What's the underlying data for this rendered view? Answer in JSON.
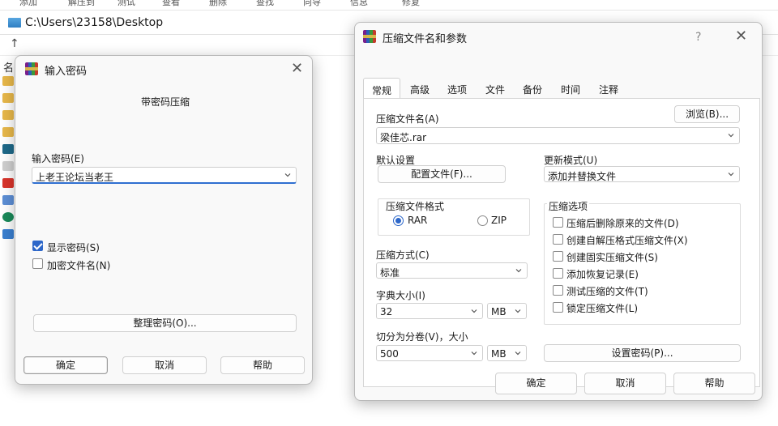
{
  "background": {
    "menu_items": [
      "添加",
      "解压到",
      "测试",
      "查看",
      "删除",
      "查找",
      "向导",
      "信息",
      "修复"
    ],
    "address_path": "C:\\Users\\23158\\Desktop",
    "column_header": "名"
  },
  "password_dialog": {
    "title": "输入密码",
    "subtitle": "带密码压缩",
    "password_label": "输入密码(E)",
    "password_value": "上老王论坛当老王",
    "show_password_label": "显示密码(S)",
    "show_password_checked": true,
    "encrypt_names_label": "加密文件名(N)",
    "encrypt_names_checked": false,
    "organize_button": "整理密码(O)...",
    "ok_button": "确定",
    "cancel_button": "取消",
    "help_button": "帮助"
  },
  "archive_dialog": {
    "title": "压缩文件名和参数",
    "help_glyph": "?",
    "tabs": [
      "常规",
      "高级",
      "选项",
      "文件",
      "备份",
      "时间",
      "注释"
    ],
    "active_tab": "常规",
    "archive_name_label": "压缩文件名(A)",
    "browse_button": "浏览(B)...",
    "archive_name_value": "梁佳芯.rar",
    "default_settings_label": "默认设置",
    "profile_button": "配置文件(F)...",
    "update_mode_label": "更新模式(U)",
    "update_mode_value": "添加并替换文件",
    "format_group_label": "压缩文件格式",
    "format_rar": "RAR",
    "format_zip": "ZIP",
    "format_selected": "RAR",
    "method_label": "压缩方式(C)",
    "method_value": "标准",
    "dict_label": "字典大小(I)",
    "dict_value": "32",
    "dict_unit": "MB",
    "split_label": "切分为分卷(V)，大小",
    "split_value": "500",
    "split_unit": "MB",
    "options_group_label": "压缩选项",
    "options": [
      {
        "label": "压缩后删除原来的文件(D)",
        "checked": false
      },
      {
        "label": "创建自解压格式压缩文件(X)",
        "checked": false
      },
      {
        "label": "创建固实压缩文件(S)",
        "checked": false
      },
      {
        "label": "添加恢复记录(E)",
        "checked": false
      },
      {
        "label": "测试压缩的文件(T)",
        "checked": false
      },
      {
        "label": "锁定压缩文件(L)",
        "checked": false
      }
    ],
    "set_password_button": "设置密码(P)...",
    "ok_button": "确定",
    "cancel_button": "取消",
    "help_button": "帮助"
  },
  "colors": {
    "accent": "#2d67c9",
    "dialog_bg": "#f9f9f9",
    "border": "#b9b9b9"
  }
}
